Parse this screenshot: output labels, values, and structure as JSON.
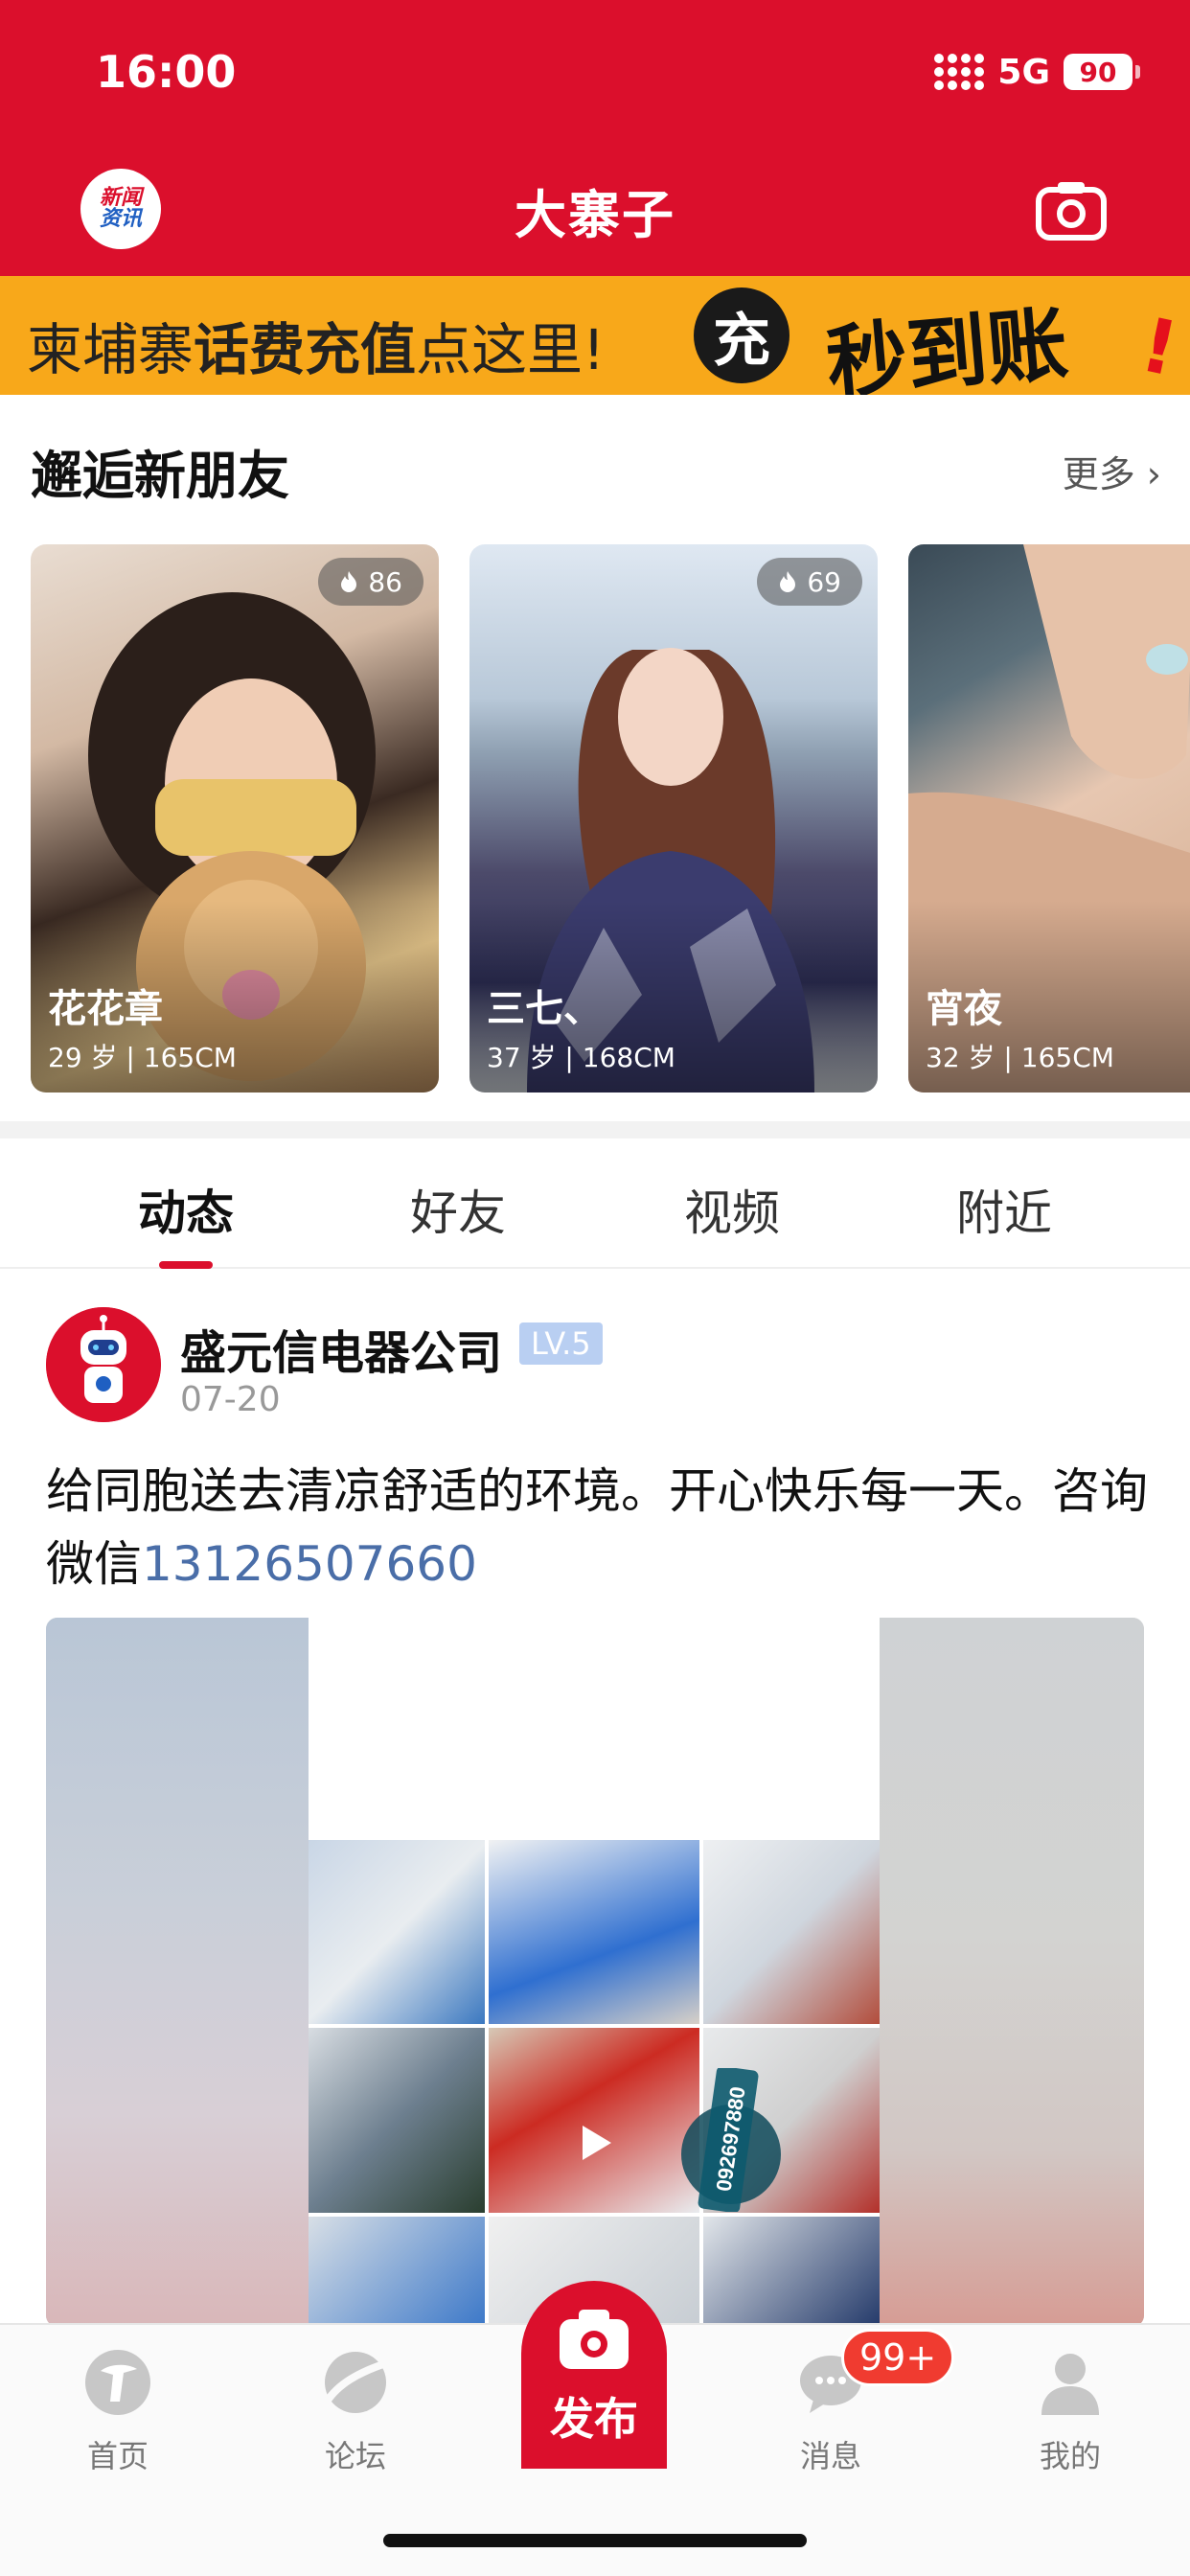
{
  "status_bar": {
    "time": "16:00",
    "network": "5G",
    "battery": "90"
  },
  "header": {
    "logo_line1": "新闻",
    "logo_line2": "资讯",
    "title": "大寨子",
    "camera_icon": "camera-icon"
  },
  "banner": {
    "part1": "柬埔寨",
    "part2": "话费充值",
    "part3": "点这里!",
    "circle_char": "充",
    "big_text": "秒到账",
    "exclaim": "!"
  },
  "friends": {
    "title": "邂逅新朋友",
    "more": "更多 ›",
    "cards": [
      {
        "name": "花花章",
        "meta": "29 岁 | 165CM",
        "heat": "86"
      },
      {
        "name": "三七、",
        "meta": "37 岁 | 168CM",
        "heat": "69"
      },
      {
        "name": "宵夜",
        "meta": "32 岁 | 165CM",
        "heat": ""
      }
    ]
  },
  "tabs": [
    {
      "label": "动态",
      "active": true
    },
    {
      "label": "好友",
      "active": false
    },
    {
      "label": "视频",
      "active": false
    },
    {
      "label": "附近",
      "active": false
    }
  ],
  "post": {
    "author": "盛元信电器公司",
    "level": "LV.5",
    "date": "07-20",
    "text": "给同胞送去清凉舒适的环境。开心快乐每一天。咨询微信",
    "phone": "13126507660",
    "watermark": "092697880"
  },
  "bottom_nav": {
    "items": [
      {
        "label": "首页",
        "icon": "home-icon"
      },
      {
        "label": "论坛",
        "icon": "forum-icon"
      },
      {
        "label": "消息",
        "icon": "message-icon"
      },
      {
        "label": "我的",
        "icon": "profile-icon"
      }
    ],
    "publish_label": "发布",
    "badge": "99+"
  },
  "colors": {
    "brand_red": "#DB0F2C",
    "banner_orange": "#F8A81A",
    "link_blue": "#4a6ea8"
  }
}
